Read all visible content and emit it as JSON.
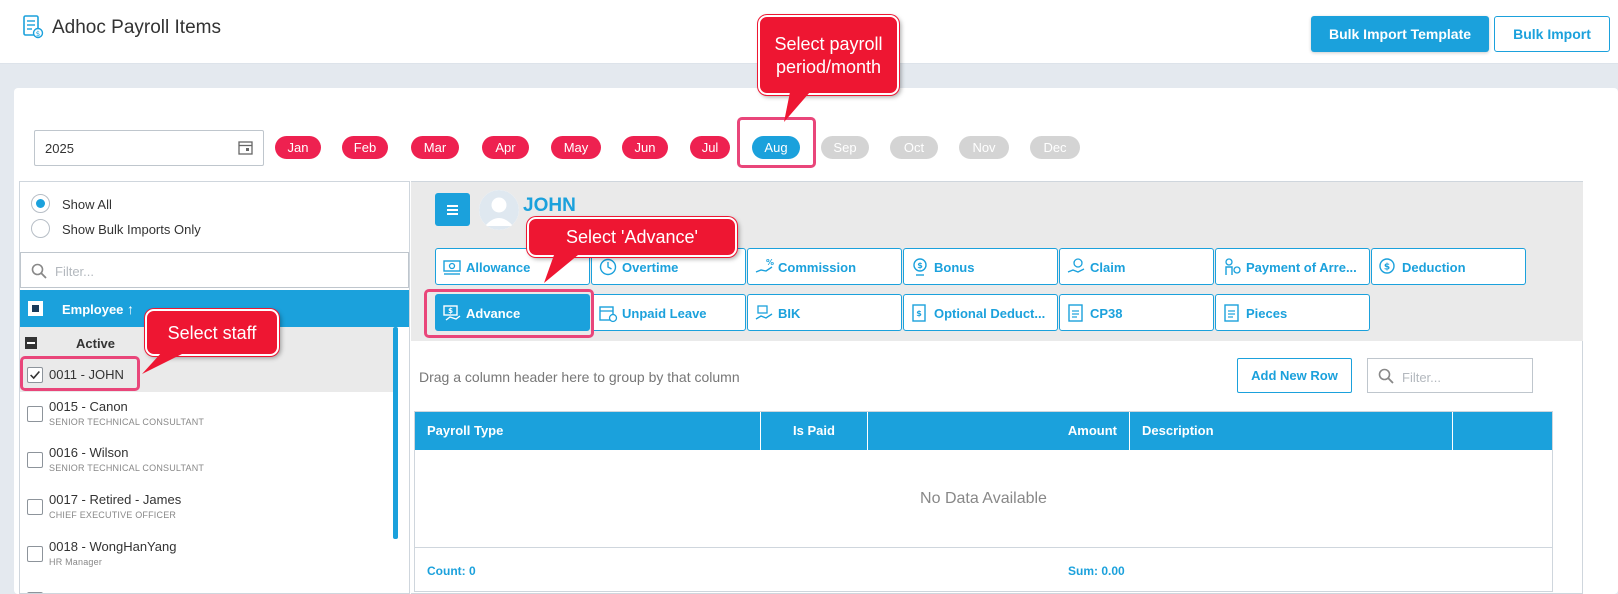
{
  "header": {
    "title": "Adhoc Payroll Items",
    "bulk_template_label": "Bulk Import Template",
    "bulk_import_label": "Bulk Import"
  },
  "period": {
    "year": "2025",
    "months": [
      {
        "label": "Jan",
        "state": "enabled"
      },
      {
        "label": "Feb",
        "state": "enabled"
      },
      {
        "label": "Mar",
        "state": "enabled"
      },
      {
        "label": "Apr",
        "state": "enabled"
      },
      {
        "label": "May",
        "state": "enabled"
      },
      {
        "label": "Jun",
        "state": "enabled"
      },
      {
        "label": "Jul",
        "state": "enabled"
      },
      {
        "label": "Aug",
        "state": "selected"
      },
      {
        "label": "Sep",
        "state": "disabled"
      },
      {
        "label": "Oct",
        "state": "disabled"
      },
      {
        "label": "Nov",
        "state": "disabled"
      },
      {
        "label": "Dec",
        "state": "disabled"
      }
    ]
  },
  "left": {
    "show_all": "Show All",
    "show_bulk": "Show Bulk Imports Only",
    "filter_placeholder": "Filter...",
    "employee_header": "Employee",
    "group_label": "Active",
    "employees": [
      {
        "name": "0011 - JOHN",
        "title": "",
        "checked": true
      },
      {
        "name": "0015 - Canon",
        "title": "SENIOR TECHNICAL CONSULTANT",
        "checked": false
      },
      {
        "name": "0016 - Wilson",
        "title": "SENIOR TECHNICAL CONSULTANT",
        "checked": false
      },
      {
        "name": "0017 - Retired - James",
        "title": "CHIEF EXECUTIVE OFFICER",
        "checked": false
      },
      {
        "name": "0018 - WongHanYang",
        "title": "HR Manager",
        "checked": false
      }
    ]
  },
  "right": {
    "employee_name": "JOHN",
    "categories_row1": [
      "Allowance",
      "Overtime",
      "Commission",
      "Bonus",
      "Claim",
      "Payment of Arre...",
      "Deduction"
    ],
    "categories_row2": [
      "Advance",
      "Unpaid Leave",
      "BIK",
      "Optional Deduct...",
      "CP38",
      "Pieces"
    ],
    "active_category": "Advance",
    "group_hint": "Drag a column header here to group by that column",
    "add_row_label": "Add New Row",
    "grid_filter_placeholder": "Filter...",
    "columns": {
      "payroll_type": "Payroll Type",
      "is_paid": "Is Paid",
      "amount": "Amount",
      "description": "Description"
    },
    "no_data": "No Data Available",
    "count": "Count: 0",
    "sum": "Sum: 0.00"
  },
  "annotations": {
    "period": "Select payroll period/month",
    "advance": "Select 'Advance'",
    "staff": "Select staff"
  },
  "colors": {
    "primary": "#1ba1dc",
    "month_active": "#ee2150",
    "month_disabled": "#d4d4d4",
    "callout": "#ee1632"
  }
}
